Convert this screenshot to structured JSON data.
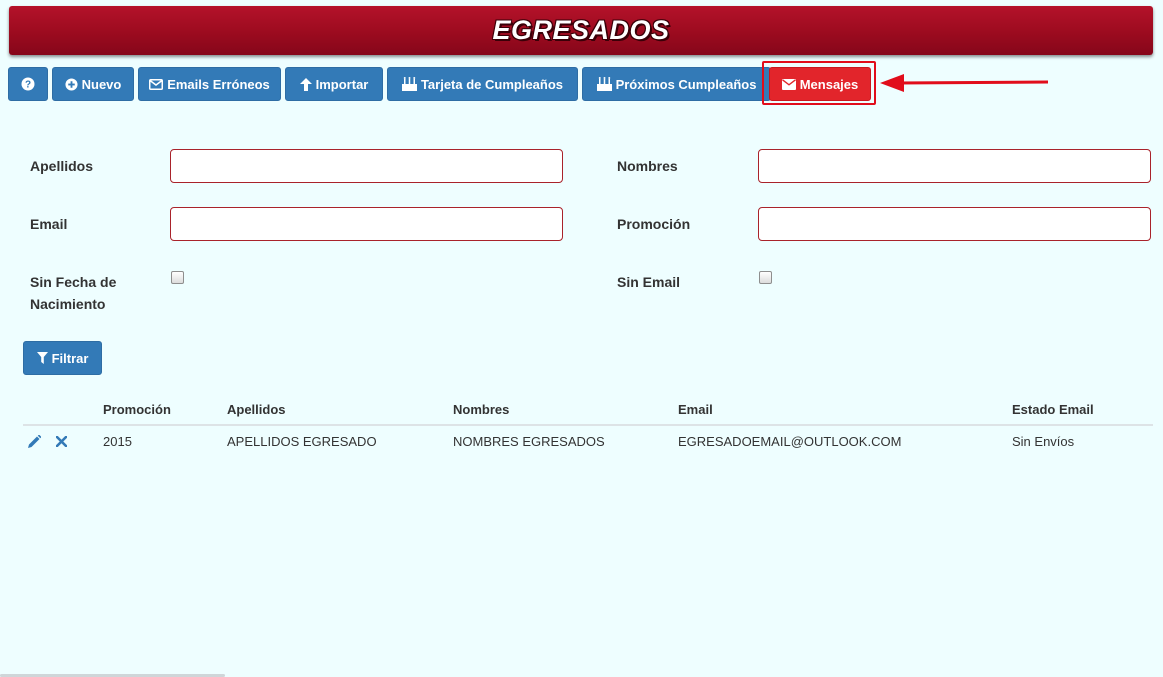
{
  "header": {
    "title": "EGRESADOS"
  },
  "toolbar": {
    "help_icon": "question-circle-icon",
    "nuevo": "Nuevo",
    "emails_erroneos": "Emails Erróneos",
    "importar": "Importar",
    "tarjeta_cumpleanos": "Tarjeta de Cumpleaños",
    "proximos_cumpleanos": "Próximos Cumpleaños",
    "mensajes": "Mensajes"
  },
  "filters": {
    "apellidos_label": "Apellidos",
    "apellidos_value": "",
    "nombres_label": "Nombres",
    "nombres_value": "",
    "email_label": "Email",
    "email_value": "",
    "promocion_label": "Promoción",
    "promocion_value": "",
    "sin_fecha_label_line1": "Sin Fecha de",
    "sin_fecha_label_line2": "Nacimiento",
    "sin_email_label": "Sin Email",
    "filtrar_button": "Filtrar"
  },
  "table": {
    "columns": [
      "Promoción",
      "Apellidos",
      "Nombres",
      "Email",
      "Estado Email"
    ],
    "rows": [
      [
        "2015",
        "APELLIDOS EGRESADO",
        "NOMBRES EGRESADOS",
        "EGRESADOEMAIL@OUTLOOK.COM",
        "Sin Envíos"
      ]
    ]
  },
  "colors": {
    "primary": "#337ab7",
    "danger": "#e2252b",
    "header": "#9c0b1f",
    "background": "#eefeff",
    "input_border": "#a9232b"
  }
}
